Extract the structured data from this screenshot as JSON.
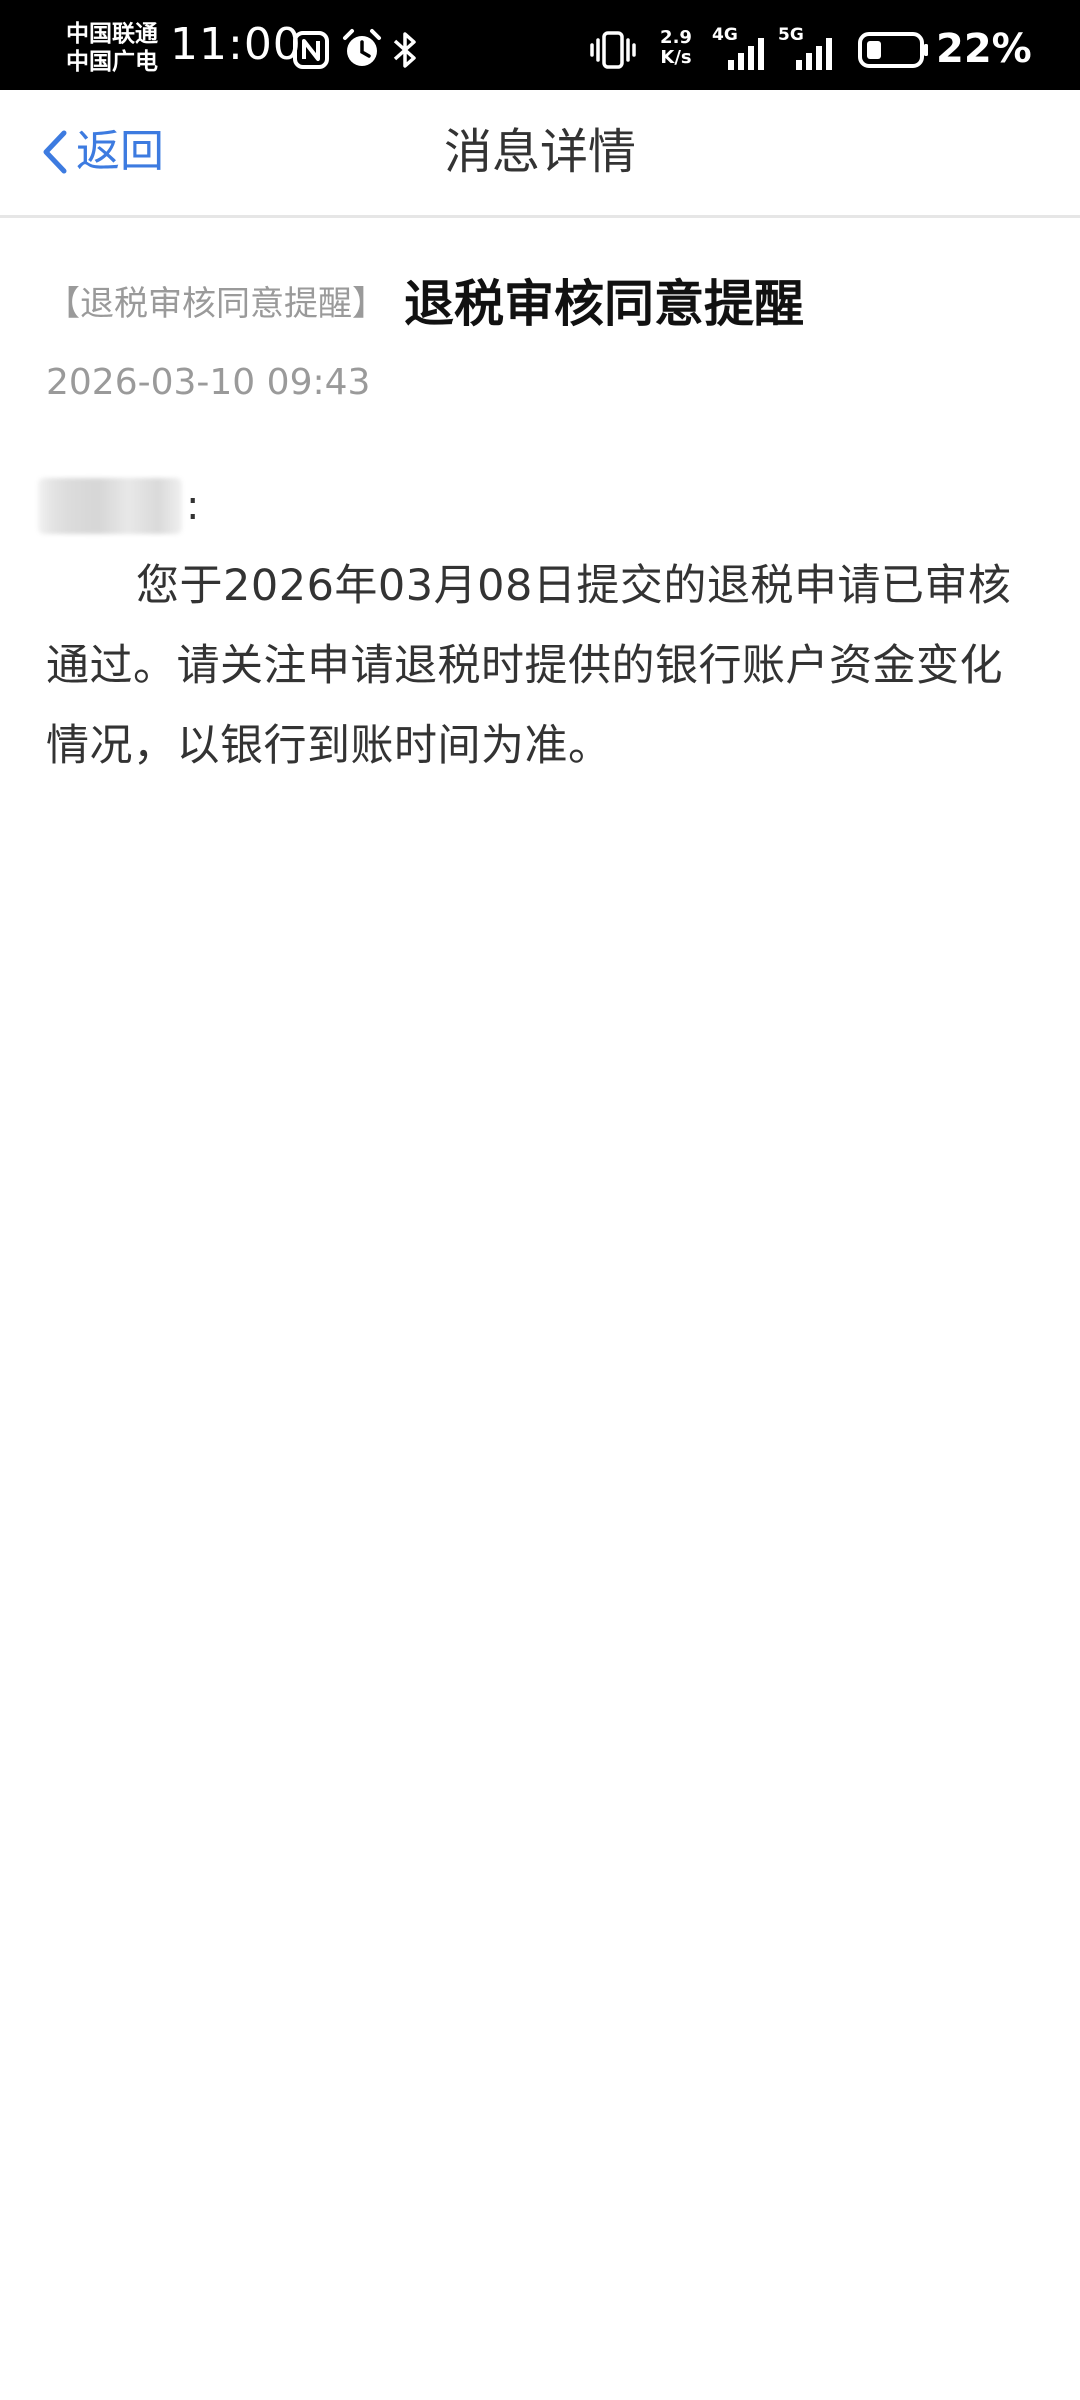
{
  "status_bar": {
    "carrier_1": "中国联通",
    "carrier_2": "中国广电",
    "time": "11:00",
    "net_speed_value": "2.9",
    "net_speed_unit": "K/s",
    "network_1": "4G",
    "network_2": "5G",
    "battery_percent": "22%",
    "icons": [
      "nfc-icon",
      "alarm-icon",
      "bluetooth-icon",
      "vibrate-icon",
      "signal-icon",
      "battery-icon"
    ]
  },
  "nav": {
    "back_label": "返回",
    "title": "消息详情"
  },
  "message": {
    "category": "【退税审核同意提醒】",
    "title": "退税审核同意提醒",
    "time": "2026-03-10 09:43",
    "recipient_suffix": ":",
    "body": "您于2026年03月08日提交的退税申请已审核通过。请关注申请退税时提供的银行账户资金变化情况，以银行到账时间为准。"
  },
  "colors": {
    "accent": "#3d7be0",
    "text_primary": "#333333",
    "text_secondary": "#9a9a9a",
    "divider": "#e6e6e6"
  }
}
